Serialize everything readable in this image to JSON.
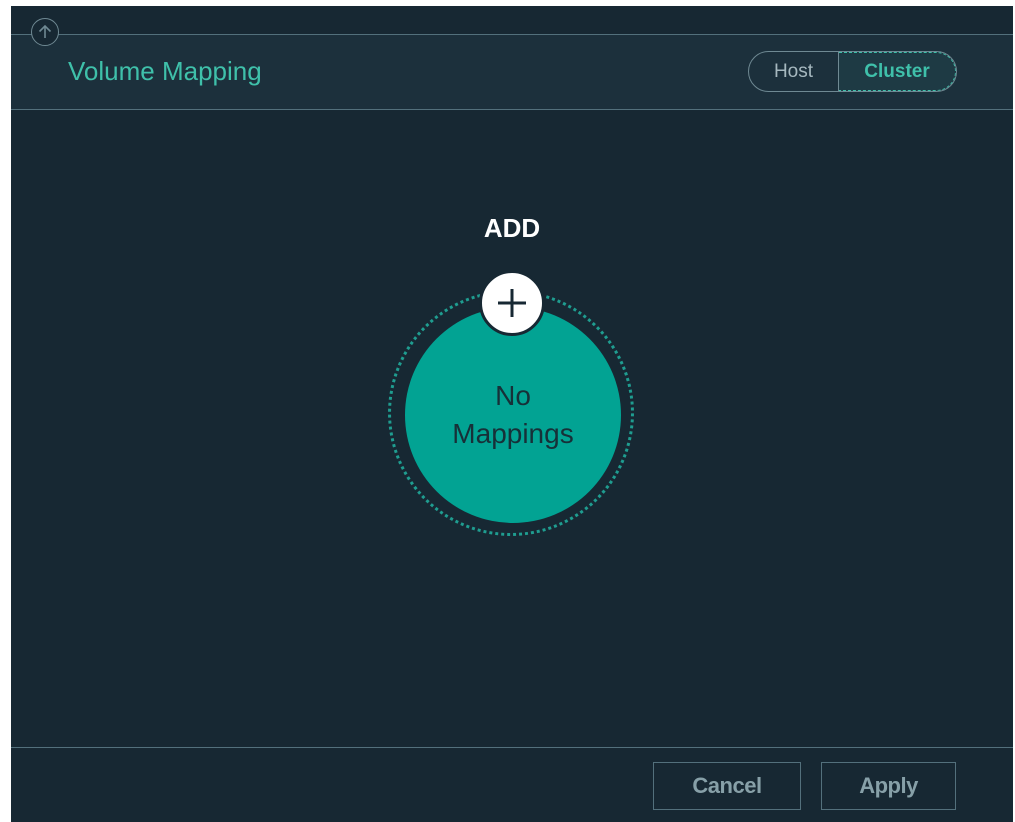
{
  "header": {
    "title": "Volume Mapping",
    "up_icon": "arrow-up-circle-icon",
    "toggle": {
      "options": [
        "Host",
        "Cluster"
      ],
      "selected": "Cluster"
    }
  },
  "main": {
    "add_label": "ADD",
    "add_icon": "plus-icon",
    "empty_line1": "No",
    "empty_line2": "Mappings"
  },
  "footer": {
    "cancel_label": "Cancel",
    "apply_label": "Apply"
  },
  "colors": {
    "background": "#172833",
    "accent": "#3fc0aa",
    "bubble": "#02a393"
  }
}
